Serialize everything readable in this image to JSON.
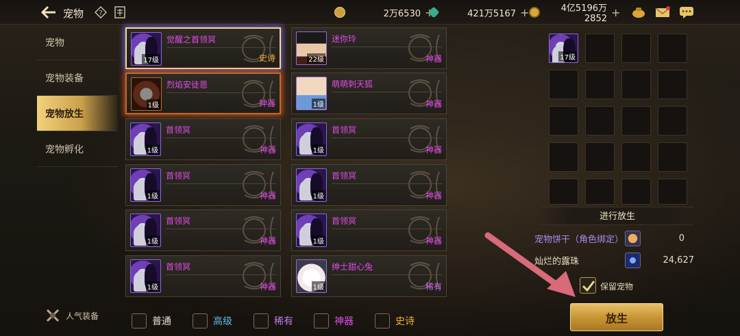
{
  "header": {
    "title": "宠物",
    "currencies": [
      {
        "name": "coin",
        "value": "2万6530",
        "color": "#d6a23a"
      },
      {
        "name": "crystal",
        "value": "421万5167",
        "color": "#4fc6a2"
      },
      {
        "name": "gold",
        "value": "4亿5196万2852",
        "color": "#e3b13f"
      }
    ],
    "plus": "+"
  },
  "sidebar": {
    "items": [
      {
        "label": "宠物"
      },
      {
        "label": "宠物装备"
      },
      {
        "label": "宠物放生"
      },
      {
        "label": "宠物孵化"
      }
    ],
    "active_index": 2,
    "popular_label": "人气装备"
  },
  "pets": [
    {
      "name": "觉醒之首领冥",
      "level": "17级",
      "rarity": "史诗",
      "thumb": "purple",
      "selected": "blue"
    },
    {
      "name": "迷你玲",
      "level": "22级",
      "rarity": "神器",
      "thumb": "boy"
    },
    {
      "name": "烈焰安徒恩",
      "level": "1级",
      "rarity": "神器",
      "thumb": "fire",
      "selected": "red"
    },
    {
      "name": "萌萌刺天狐",
      "level": "1级",
      "rarity": "神器",
      "thumb": "fox"
    },
    {
      "name": "首领冥",
      "level": "1级",
      "rarity": "神器",
      "thumb": "purple"
    },
    {
      "name": "首领冥",
      "level": "1级",
      "rarity": "神器",
      "thumb": "purple"
    },
    {
      "name": "首领冥",
      "level": "1级",
      "rarity": "神器",
      "thumb": "purple"
    },
    {
      "name": "首领冥",
      "level": "1级",
      "rarity": "神器",
      "thumb": "purple"
    },
    {
      "name": "首领冥",
      "level": "1级",
      "rarity": "神器",
      "thumb": "purple"
    },
    {
      "name": "首领冥",
      "level": "1级",
      "rarity": "神器",
      "thumb": "purple"
    },
    {
      "name": "首领冥",
      "level": "1级",
      "rarity": "神器",
      "thumb": "purple"
    },
    {
      "name": "绅士甜心兔",
      "level": "1级",
      "rarity": "稀有",
      "thumb": "bunny"
    }
  ],
  "release_panel": {
    "slot_filled_level": "17级",
    "header": "进行放生",
    "rewards": [
      {
        "label": "宠物饼干（角色绑定）",
        "value": "0",
        "label_color": "#a48cf0"
      },
      {
        "label": "灿烂的露珠",
        "value": "24,627",
        "label_color": "#e8dcc2"
      }
    ],
    "keep_label": "保留宠物",
    "keep_checked": true,
    "release_button": "放生"
  },
  "filters": [
    {
      "label": "普通",
      "color": "#e8e0d0"
    },
    {
      "label": "高级",
      "color": "#5fb8e8"
    },
    {
      "label": "稀有",
      "color": "#c37ae8"
    },
    {
      "label": "神器",
      "color": "#e04de8"
    },
    {
      "label": "史诗",
      "color": "#f0b030"
    }
  ]
}
